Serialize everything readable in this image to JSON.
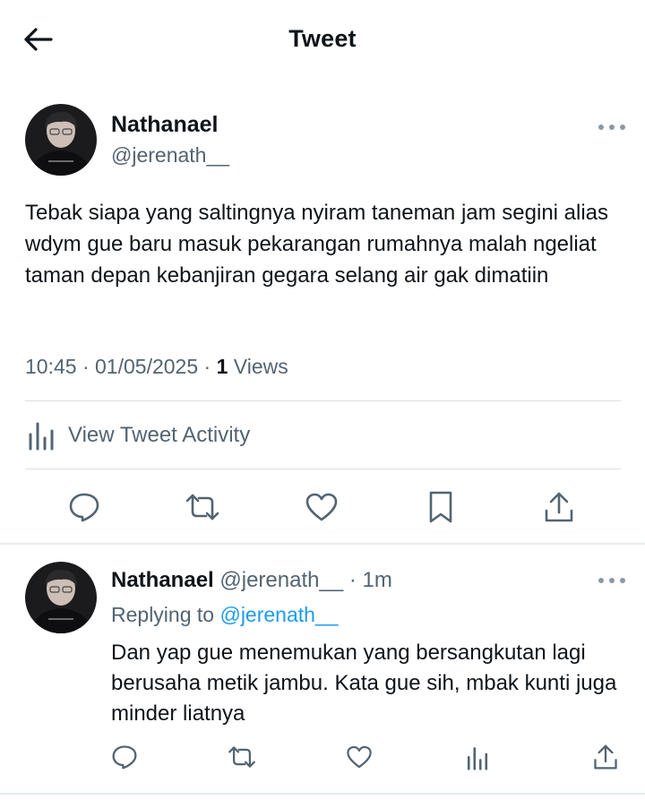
{
  "header": {
    "title": "Tweet"
  },
  "tweet": {
    "author_name": "Nathanael",
    "author_handle": "@jerenath__",
    "text": "Tebak siapa yang saltingnya nyiram taneman jam segini alias wdym gue baru masuk pekarangan rumahnya malah ngeliat taman depan kebanjiran gegara selang air gak dimatiin",
    "time": "10:45",
    "date": "01/05/2025",
    "views_count": "1",
    "views_label": "Views",
    "activity_label": "View Tweet Activity"
  },
  "reply": {
    "author_name": "Nathanael",
    "author_handle": "@jerenath__",
    "time_ago": "1m",
    "replying_prefix": "Replying to",
    "replying_to": "@jerenath__",
    "text": "Dan yap gue menemukan yang bersangkutan lagi berusaha metik jambu. Kata gue sih, mbak kunti juga minder liatnya"
  },
  "colors": {
    "text_primary": "#0f1419",
    "text_secondary": "#536471",
    "link": "#1d9bf0",
    "divider": "#dadfe3"
  },
  "icons": {
    "back": "arrow-left-icon",
    "more": "more-horizontal-icon",
    "analytics": "bar-chart-icon",
    "reply": "speech-bubble-icon",
    "retweet": "retweet-icon",
    "like": "heart-icon",
    "bookmark": "bookmark-icon",
    "share": "share-upload-icon"
  }
}
